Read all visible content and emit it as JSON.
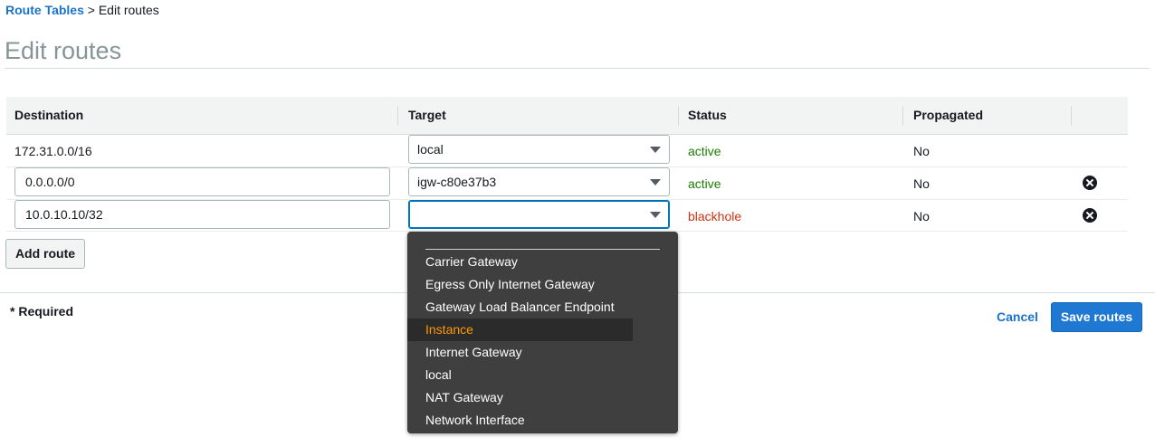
{
  "breadcrumb": {
    "parent": "Route Tables",
    "separator": ">",
    "current": "Edit routes"
  },
  "page_title": "Edit routes",
  "table": {
    "columns": [
      "Destination",
      "Target",
      "Status",
      "Propagated"
    ],
    "rows": [
      {
        "destination": "172.31.0.0/16",
        "target": "local",
        "status": "active",
        "propagated": "No",
        "removable": false
      },
      {
        "destination": "0.0.0.0/0",
        "target": "igw-c80e37b3",
        "status": "active",
        "propagated": "No",
        "removable": true
      },
      {
        "destination": "10.0.10.10/32",
        "target": "",
        "status": "blackhole",
        "propagated": "No",
        "removable": true
      }
    ]
  },
  "add_route_label": "Add route",
  "required_note": "* Required",
  "cancel_label": "Cancel",
  "save_label": "Save routes",
  "target_dropdown": {
    "options": [
      "Carrier Gateway",
      "Egress Only Internet Gateway",
      "Gateway Load Balancer Endpoint",
      "Instance",
      "Internet Gateway",
      "local",
      "NAT Gateway",
      "Network Interface"
    ],
    "highlighted": "Instance"
  },
  "colors": {
    "link": "#1a73c7",
    "active": "#1d8102",
    "blackhole": "#d13212",
    "primary_button": "#1f78d1",
    "dropdown_bg": "#3f3f3f",
    "highlight_text": "#ff9900"
  },
  "icons": {
    "remove": "close-circle-icon",
    "caret": "caret-down-icon"
  }
}
